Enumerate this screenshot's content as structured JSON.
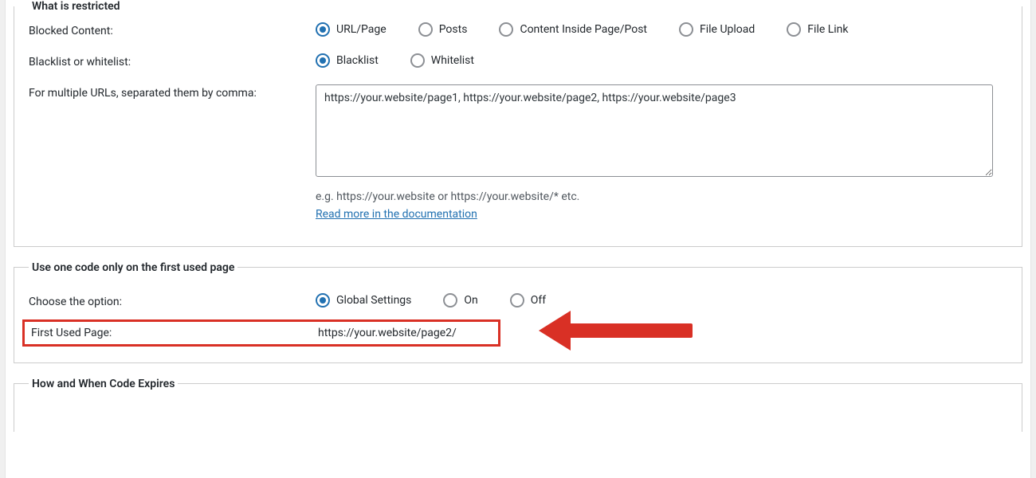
{
  "section_restricted": {
    "legend": "What is restricted",
    "blocked_content_label": "Blocked Content:",
    "blocked_content_options": {
      "url_page": "URL/Page",
      "posts": "Posts",
      "content_inside": "Content Inside Page/Post",
      "file_upload": "File Upload",
      "file_link": "File Link"
    },
    "blacklist_whitelist_label": "Blacklist or whitelist:",
    "blacklist_whitelist_options": {
      "blacklist": "Blacklist",
      "whitelist": "Whitelist"
    },
    "multiple_urls_label": "For multiple URLs, separated them by comma:",
    "multiple_urls_value": "https://your.website/page1, https://your.website/page2, https://your.website/page3",
    "hint_eg": "e.g. https://your.website or https://your.website/* etc.",
    "hint_link": "Read more in the documentation"
  },
  "section_first_used": {
    "legend": "Use one code only on the first used page",
    "choose_option_label": "Choose the option:",
    "options": {
      "global": "Global Settings",
      "on": "On",
      "off": "Off"
    },
    "first_used_page_label": "First Used Page:",
    "first_used_page_value": "https://your.website/page2/"
  },
  "section_expires": {
    "legend": "How and When Code Expires"
  }
}
